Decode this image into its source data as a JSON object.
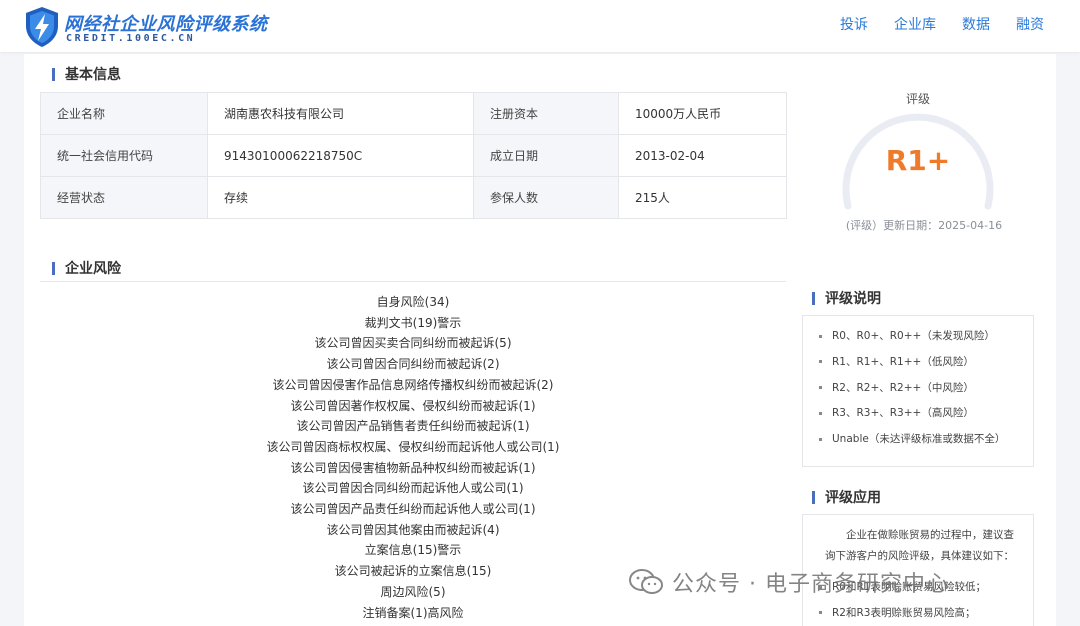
{
  "header": {
    "brand_cn": "网经社企业风险评级系统",
    "brand_en": "CREDIT.100EC.CN",
    "nav": [
      "投诉",
      "企业库",
      "数据",
      "融资"
    ]
  },
  "basic_info": {
    "title": "基本信息",
    "rows": [
      [
        {
          "label": "企业名称",
          "value": "湖南惠农科技有限公司"
        },
        {
          "label": "注册资本",
          "value": "10000万人民币"
        }
      ],
      [
        {
          "label": "统一社会信用代码",
          "value": "91430100062218750C"
        },
        {
          "label": "成立日期",
          "value": "2013-02-04"
        }
      ],
      [
        {
          "label": "经营状态",
          "value": "存续"
        },
        {
          "label": "参保人数",
          "value": "215人"
        }
      ]
    ]
  },
  "rating": {
    "label": "评级",
    "value": "R1+",
    "update": "(评级）更新日期：2025-04-16",
    "color": "#ef7a2a"
  },
  "risk": {
    "title": "企业风险",
    "items": [
      "自身风险(34)",
      "裁判文书(19)警示",
      "该公司曾因买卖合同纠纷而被起诉(5)",
      "该公司曾因合同纠纷而被起诉(2)",
      "该公司曾因侵害作品信息网络传播权纠纷而被起诉(2)",
      "该公司曾因著作权权属、侵权纠纷而被起诉(1)",
      "该公司曾因产品销售者责任纠纷而被起诉(1)",
      "该公司曾因商标权权属、侵权纠纷而起诉他人或公司(1)",
      "该公司曾因侵害植物新品种权纠纷而被起诉(1)",
      "该公司曾因合同纠纷而起诉他人或公司(1)",
      "该公司曾因产品责任纠纷而起诉他人或公司(1)",
      "该公司曾因其他案由而被起诉(4)",
      "立案信息(15)警示",
      "该公司被起诉的立案信息(15)",
      "周边风险(5)",
      "注销备案(1)高风险"
    ]
  },
  "rating_desc": {
    "title": "评级说明",
    "items": [
      "R0、R0+、R0++（未发现风险）",
      "R1、R1+、R1++（低风险）",
      "R2、R2+、R2++（中风险）",
      "R3、R3+、R3++（高风险）",
      "Unable（未达评级标准或数据不全）"
    ]
  },
  "rating_app": {
    "title": "评级应用",
    "text": "企业在做赊账贸易的过程中，建议查询下游客户的风险评级，具体建议如下：",
    "items": [
      "R0和R1表明赊账贸易风险较低；",
      "R2和R3表明赊账贸易风险高；"
    ]
  },
  "watermark": {
    "text": "公众号 · 电子商务研究中心"
  }
}
